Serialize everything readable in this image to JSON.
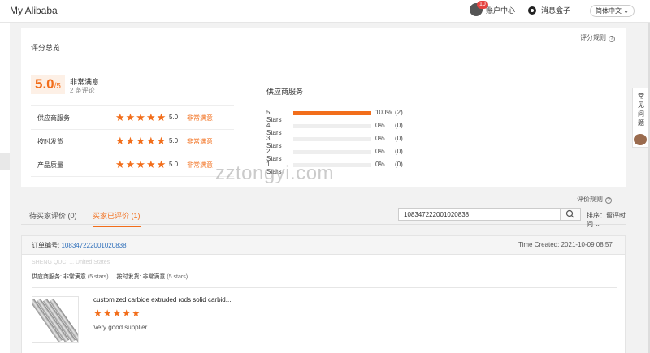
{
  "header": {
    "brand": "My Alibaba",
    "notification_count": "10",
    "account_center": "账户中心",
    "message_box": "消息盒子",
    "language": "简体中文"
  },
  "summary": {
    "title": "评分总览",
    "rule_link": "评分规则",
    "score": "5.0",
    "score_denominator": "/5",
    "verbal": "非常满意",
    "review_count": "2 条评论",
    "scales": [
      {
        "label": "供应商服务",
        "stars": "★★★★★",
        "value": "5.0",
        "verbal": "非常满意"
      },
      {
        "label": "按时发货",
        "stars": "★★★★★",
        "value": "5.0",
        "verbal": "非常满意"
      },
      {
        "label": "产品质量",
        "stars": "★★★★★",
        "value": "5.0",
        "verbal": "非常满意"
      }
    ],
    "supplier_service_title": "供应商服务",
    "distribution": [
      {
        "label": "5 Stars",
        "percent": 100,
        "percent_text": "100%",
        "count": "(2)"
      },
      {
        "label": "4 Stars",
        "percent": 0,
        "percent_text": "0%",
        "count": "(0)"
      },
      {
        "label": "3 Stars",
        "percent": 0,
        "percent_text": "0%",
        "count": "(0)"
      },
      {
        "label": "2 Stars",
        "percent": 0,
        "percent_text": "0%",
        "count": "(0)"
      },
      {
        "label": "1 Stars",
        "percent": 0,
        "percent_text": "0%",
        "count": "(0)"
      }
    ]
  },
  "reviews": {
    "rule_link": "评价规则",
    "tabs": [
      {
        "label": "待买家评价 (0)"
      },
      {
        "label": "买家已评价 (1)"
      }
    ],
    "search_value": "108347222001020838",
    "sort_label": "排序：留评时间"
  },
  "order": {
    "order_label": "订单编号:",
    "order_id": "108347222001020838",
    "time_created": "Time Created: 2021-10-09 08:57",
    "faint_text": "SHENG QUCI ... United States",
    "supplier_rating_label": "供应商服务:",
    "supplier_rating_value": "非常满意",
    "supplier_rating_stars": "(5 stars)",
    "shipping_rating_label": "按时发货:",
    "shipping_rating_value": "非常满意",
    "shipping_rating_stars": "(5 stars)",
    "product_name": "customized carbide extruded rods solid carbid...",
    "product_stars": "★★★★★",
    "comment": "Very good supplier"
  },
  "helper": {
    "text": "常见问题"
  },
  "watermark": "zztongyi.com",
  "colors": {
    "accent": "#f26e1b",
    "link": "#2f6fba"
  }
}
